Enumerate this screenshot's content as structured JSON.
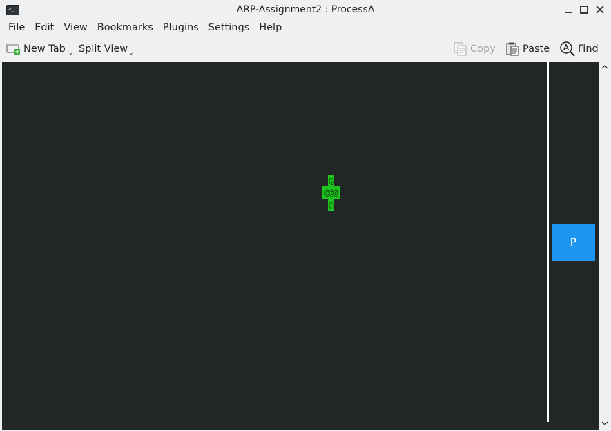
{
  "window": {
    "title": "ARP-Assignment2 : ProcessA",
    "icon": "terminal-icon"
  },
  "menu": {
    "items": [
      "File",
      "Edit",
      "View",
      "Bookmarks",
      "Plugins",
      "Settings",
      "Help"
    ]
  },
  "toolbar": {
    "new_tab": "New Tab",
    "split_view": "Split View",
    "copy": "Copy",
    "paste": "Paste",
    "find": "Find"
  },
  "terminal": {
    "sprite": {
      "top": "@",
      "middle": "@@@",
      "bottom": "@",
      "color": "#1ec51e"
    },
    "side_box": {
      "label": "P",
      "color": "#1e95ef"
    },
    "background": "#232627"
  }
}
